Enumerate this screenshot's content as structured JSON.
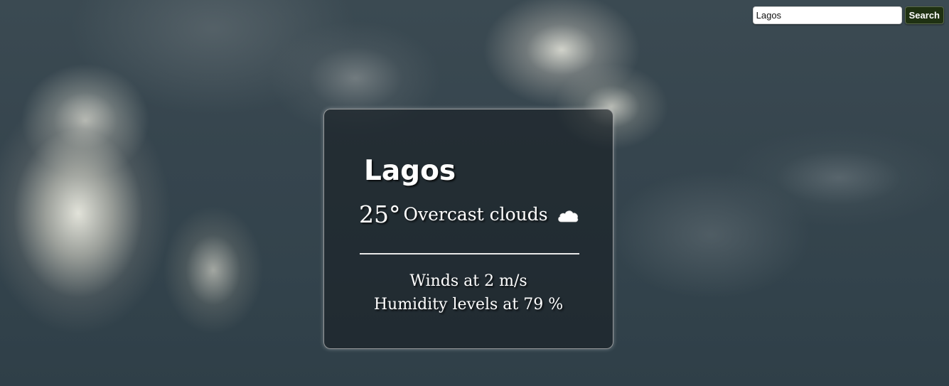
{
  "search": {
    "value": "Lagos",
    "button_label": "Search"
  },
  "weather": {
    "city": "Lagos",
    "temperature": "25°",
    "description": "Overcast clouds",
    "icon": "cloud-icon",
    "wind": "Winds at 2 m/s",
    "humidity": "Humidity levels at 79 %"
  },
  "colors": {
    "button_background": "#1f3112",
    "card_background": "rgba(25,30,35,0.62)"
  }
}
